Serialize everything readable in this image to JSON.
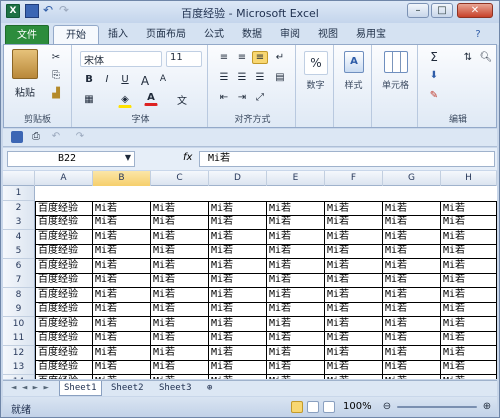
{
  "window": {
    "title": "百度经验 - Microsoft Excel"
  },
  "tabs": [
    "文件",
    "开始",
    "插入",
    "页面布局",
    "公式",
    "数据",
    "审阅",
    "视图",
    "易用宝"
  ],
  "ribbon": {
    "clipboard": {
      "paste": "粘贴",
      "label": "剪贴板"
    },
    "font": {
      "name": "宋体",
      "size": "11",
      "bold": "B",
      "italic": "I",
      "underline": "U",
      "grow": "A",
      "shrink": "A",
      "color_letter": "A",
      "label": "字体"
    },
    "align": {
      "label": "对齐方式"
    },
    "number": {
      "percent": "%",
      "label": "数字"
    },
    "styles": {
      "label": "样式"
    },
    "cells": {
      "label": "单元格"
    },
    "editing": {
      "sigma": "Σ",
      "label": "编辑"
    }
  },
  "formula_bar": {
    "name_box": "B22",
    "fx": "fx",
    "value": "Mi若"
  },
  "grid": {
    "columns": [
      "A",
      "B",
      "C",
      "D",
      "E",
      "F",
      "G",
      "H"
    ],
    "selected_column": "B",
    "rows": [
      "1",
      "2",
      "3",
      "4",
      "5",
      "6",
      "7",
      "8",
      "9",
      "10",
      "11",
      "12",
      "13",
      "14"
    ],
    "col_a_value": "百度经验",
    "other_value": "Mi若"
  },
  "sheets": [
    "Sheet1",
    "Sheet2",
    "Sheet3"
  ],
  "status": {
    "text": "就绪",
    "zoom": "100%"
  },
  "colors": {
    "accent": "#2c8c3c",
    "selected": "#f6cf6c"
  }
}
